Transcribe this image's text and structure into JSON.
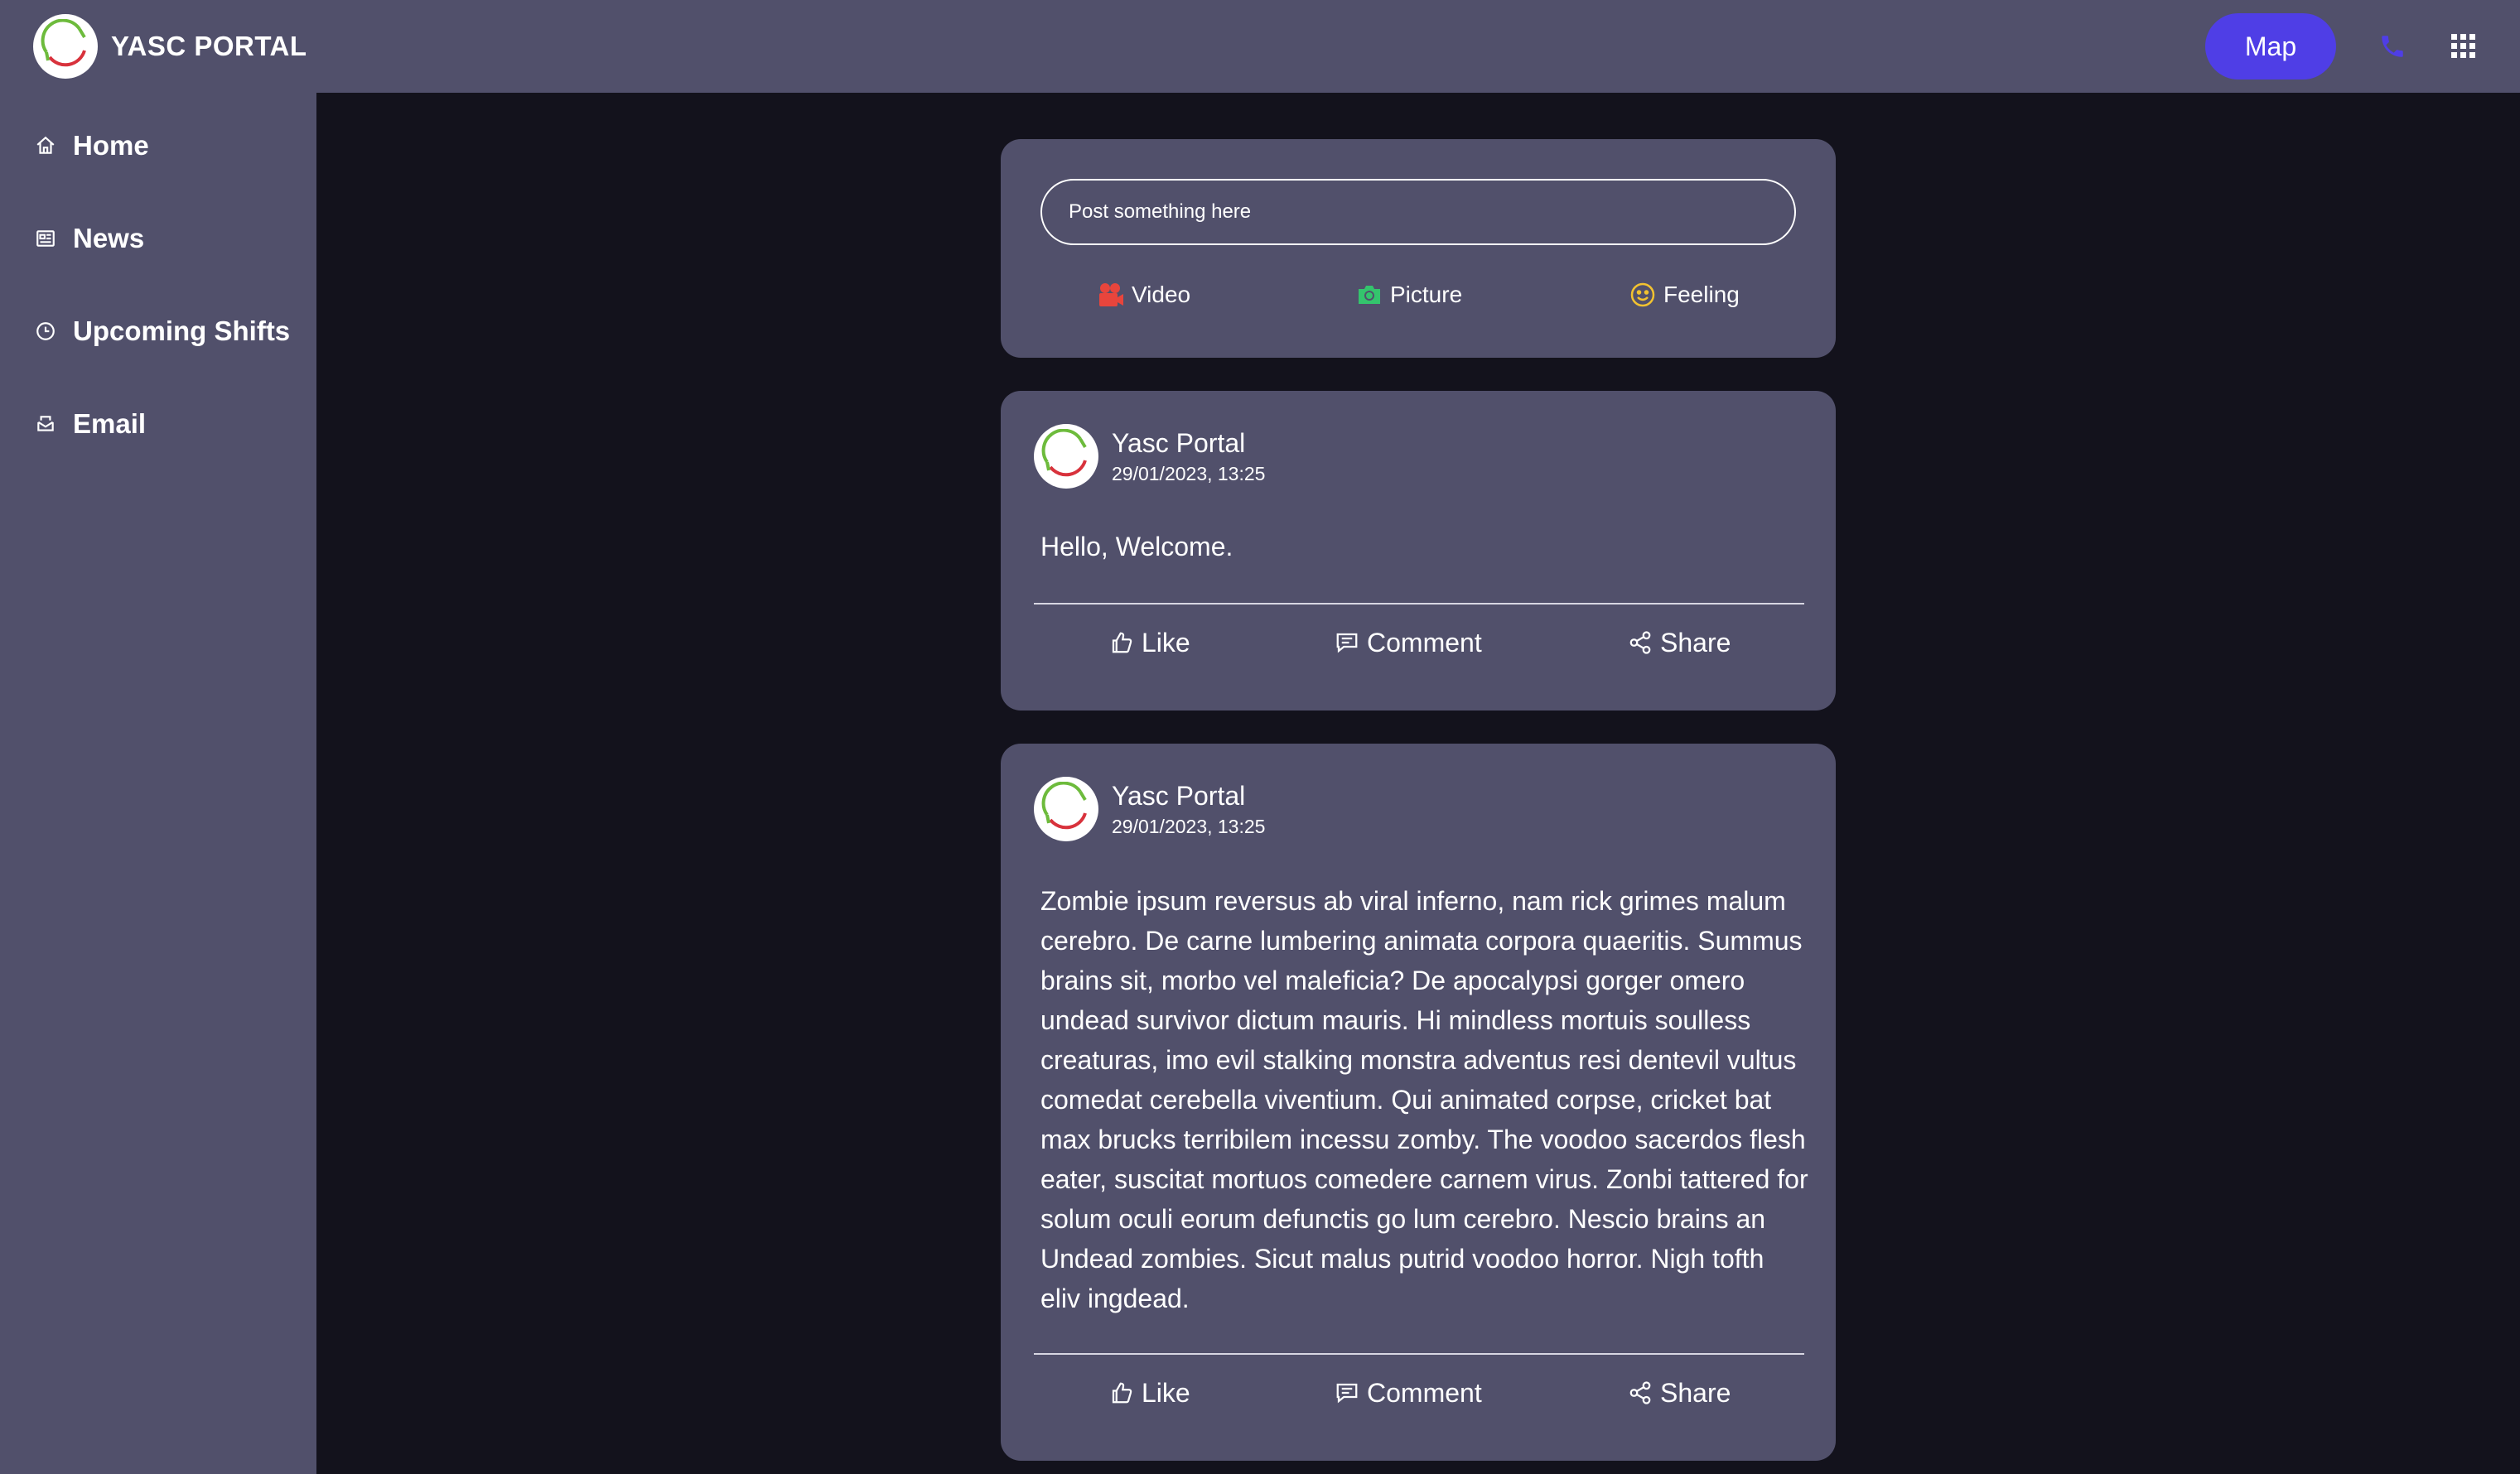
{
  "app": {
    "title": "YASC PORTAL"
  },
  "header": {
    "map_label": "Map",
    "icons": [
      "phone-icon",
      "apps-grid-icon"
    ]
  },
  "sidebar": {
    "items": [
      {
        "label": "Home",
        "icon": "home-icon"
      },
      {
        "label": "News",
        "icon": "newspaper-icon"
      },
      {
        "label": "Upcoming Shifts",
        "icon": "clock-icon"
      },
      {
        "label": "Email",
        "icon": "mail-icon"
      }
    ]
  },
  "composer": {
    "placeholder": "Post something here",
    "actions": [
      {
        "label": "Video",
        "icon": "video-camera-icon",
        "color": "#e8453c"
      },
      {
        "label": "Picture",
        "icon": "camera-icon",
        "color": "#34c46d"
      },
      {
        "label": "Feeling",
        "icon": "smiley-icon",
        "color": "#f2c230"
      }
    ]
  },
  "posts": [
    {
      "author": "Yasc Portal",
      "time": "29/01/2023, 13:25",
      "body": "Hello, Welcome.",
      "actions": [
        "Like",
        "Comment",
        "Share"
      ]
    },
    {
      "author": "Yasc Portal",
      "time": "29/01/2023, 13:25",
      "body": "Zombie ipsum reversus ab viral inferno, nam rick grimes malum cerebro. De carne lumbering animata corpora quaeritis. Summus brains sit, morbo vel maleficia? De apocalypsi gorger omero undead survivor dictum mauris. Hi mindless mortuis soulless creaturas, imo evil stalking monstra adventus resi dentevil vultus comedat cerebella viventium. Qui animated corpse, cricket bat max brucks terribilem incessu zomby. The voodoo sacerdos flesh eater, suscitat mortuos comedere carnem virus. Zonbi tattered for solum oculi eorum defunctis go lum cerebro. Nescio brains an Undead zombies. Sicut malus putrid voodoo horror. Nigh tofth eliv ingdead.",
      "actions": [
        "Like",
        "Comment",
        "Share"
      ]
    }
  ],
  "colors": {
    "background": "#13121c",
    "panel": "#51506b",
    "accent": "#4f3ee6",
    "logo_green": "#6dbb3c",
    "logo_red": "#d8323c"
  }
}
